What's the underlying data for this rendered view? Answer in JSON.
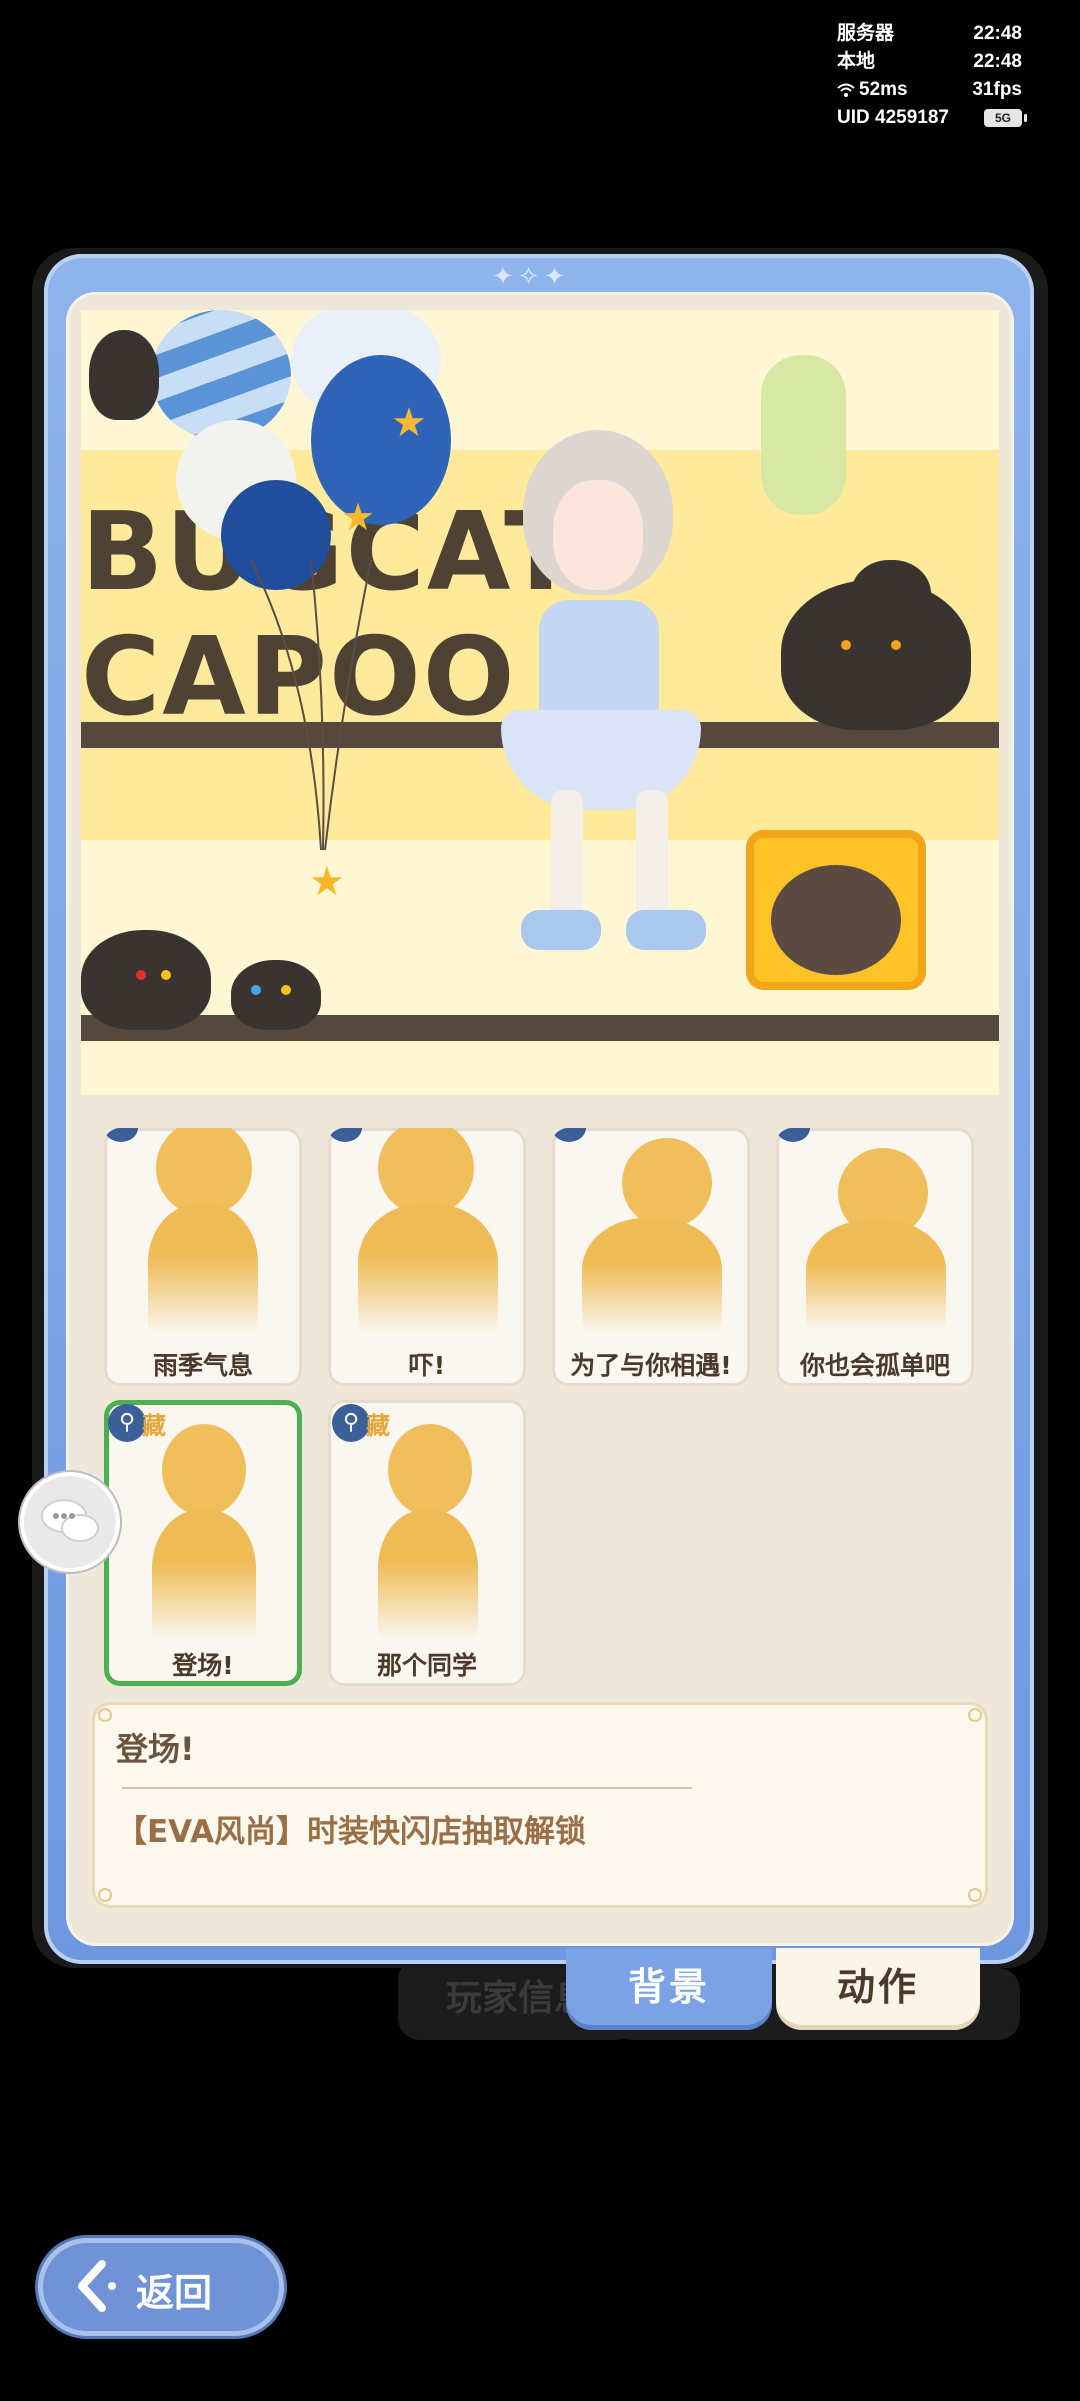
{
  "status": {
    "server_label": "服务器",
    "server_time": "22:48",
    "local_label": "本地",
    "local_time": "22:48",
    "ping": "52ms",
    "fps": "31fps",
    "uid_label": "UID",
    "uid": "4259187",
    "signal": "5G"
  },
  "background_tabs": {
    "player_info": "玩家信息"
  },
  "scene": {
    "logo_text": "BUGCAT CAPOO"
  },
  "emotes": [
    {
      "label": "雨季气息"
    },
    {
      "label": "吓!"
    },
    {
      "label": "为了与你相遇!"
    },
    {
      "label": "你也会孤单吧"
    },
    {
      "label": "登场!",
      "locked": true,
      "lock_text": "藏",
      "selected": true
    },
    {
      "label": "那个同学",
      "locked": true,
      "lock_text": "藏"
    }
  ],
  "description": {
    "title": "登场!",
    "text": "【EVA风尚】时装快闪店抽取解锁"
  },
  "tabs": {
    "background": "背景",
    "action": "动作"
  },
  "back_label": "返回"
}
